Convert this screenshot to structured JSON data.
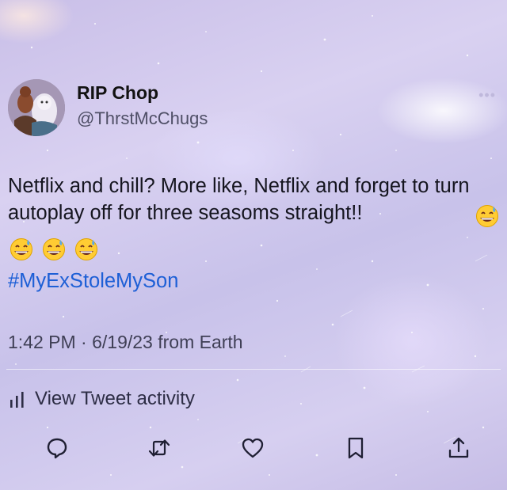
{
  "user": {
    "display_name": "RIP Chop",
    "handle": "@ThrstMcChugs",
    "avatar_icon": "avatar-photo"
  },
  "tweet": {
    "text": "Netflix and chill? More like, Netflix and forget to turn autoplay off for three seasoms straight!!",
    "emoji_icon": "grinning-face-with-sweat-icon",
    "emoji_count": 4,
    "hashtag": "#MyExStoleMySon",
    "timestamp": "1:42 PM · 6/19/23 from Earth"
  },
  "activity": {
    "label": "View Tweet activity",
    "icon": "bar-chart-icon"
  },
  "actions": [
    {
      "name": "reply",
      "icon": "reply-icon"
    },
    {
      "name": "retweet",
      "icon": "retweet-icon"
    },
    {
      "name": "like",
      "icon": "heart-icon"
    },
    {
      "name": "bookmark",
      "icon": "bookmark-icon"
    },
    {
      "name": "share",
      "icon": "share-icon"
    }
  ],
  "colors": {
    "text": "#15151f",
    "link": "#1d5fd6",
    "secondary": "#4f4f66"
  }
}
